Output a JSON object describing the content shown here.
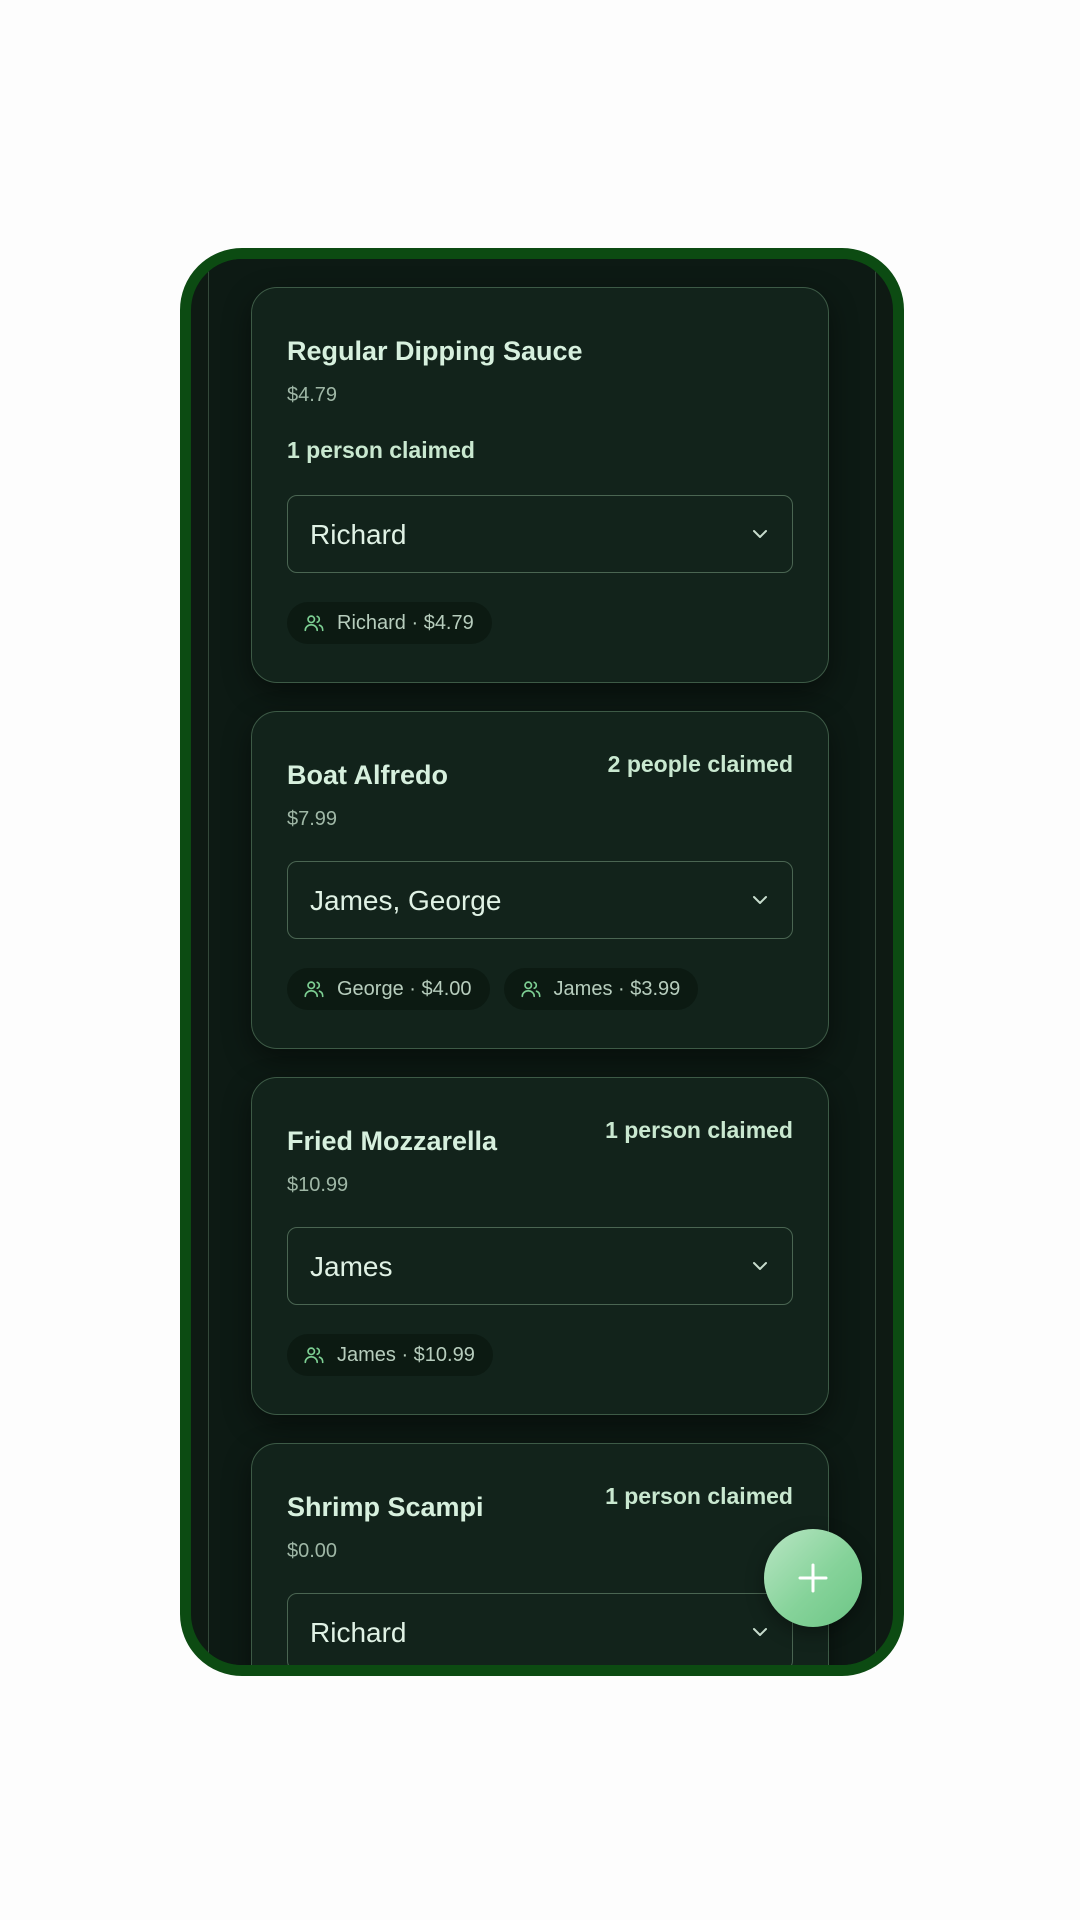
{
  "theme": {
    "frame_color": "#0c4b12",
    "card_bg": "#12231b",
    "accent": "#7dcf93",
    "fab_gradient": [
      "#b9e6c4",
      "#6cc585"
    ]
  },
  "items": [
    {
      "name": "Regular Dipping Sauce",
      "price": "$4.79",
      "claimed": "1 person claimed",
      "selected": "Richard",
      "chips": [
        "Richard · $4.79"
      ]
    },
    {
      "name": "Boat Alfredo",
      "price": "$7.99",
      "claimed": "2 people claimed",
      "selected": "James, George",
      "chips": [
        "George · $4.00",
        "James · $3.99"
      ]
    },
    {
      "name": "Fried Mozzarella",
      "price": "$10.99",
      "claimed": "1 person claimed",
      "selected": "James",
      "chips": [
        "James · $10.99"
      ]
    },
    {
      "name": "Shrimp Scampi",
      "price": "$0.00",
      "claimed": "1 person claimed",
      "selected": "Richard",
      "chips": []
    }
  ],
  "icons": {
    "chip": "users-icon",
    "select": "chevron-down-icon",
    "fab": "plus-icon"
  }
}
